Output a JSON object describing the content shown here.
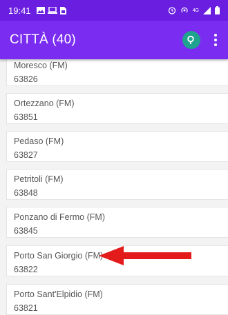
{
  "status_bar": {
    "time": "19:41",
    "network": "4G"
  },
  "app_bar": {
    "title": "CITTÀ (40)",
    "search_icon": "search-icon",
    "more_icon": "more-vertical-icon"
  },
  "cities": [
    {
      "name": "Moresco (FM)",
      "cap": "63826"
    },
    {
      "name": "Ortezzano (FM)",
      "cap": "63851"
    },
    {
      "name": "Pedaso (FM)",
      "cap": "63827"
    },
    {
      "name": "Petritoli (FM)",
      "cap": "63848"
    },
    {
      "name": "Ponzano di Fermo (FM)",
      "cap": "63845"
    },
    {
      "name": "Porto San Giorgio (FM)",
      "cap": "63822"
    },
    {
      "name": "Porto Sant'Elpidio (FM)",
      "cap": "63821"
    }
  ],
  "colors": {
    "status_bar": "#6a1fe0",
    "app_bar": "#7a2cf0",
    "search_button": "#1fa38f",
    "arrow": "#e31b1b"
  }
}
